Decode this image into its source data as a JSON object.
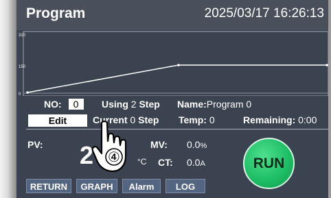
{
  "header": {
    "title": "Program",
    "datetime": "2025/03/17   16:26:13"
  },
  "graph": {
    "y_ticks": [
      "310",
      "150",
      "0"
    ]
  },
  "program": {
    "no_label": "NO:",
    "no_value": "0",
    "using_label": "Using",
    "using_value": "2",
    "step_label": "Step",
    "name_label": "Name:",
    "name_value": "Program 0",
    "edit_label": "Edit",
    "current_label": "Current",
    "current_value": "0",
    "current_step_label": "Step",
    "temp_label": "Temp:",
    "temp_value": "0",
    "remaining_label": "Remaining:",
    "remaining_value": "0:00"
  },
  "readings": {
    "pv_label": "PV:",
    "pv_value": "2",
    "unit_c": "°C",
    "mv_label": "MV:",
    "mv_value": "0.0",
    "mv_unit": "%",
    "ct_label": "CT:",
    "ct_value": "0.0",
    "ct_unit": "A"
  },
  "run_label": "RUN",
  "footer": {
    "return_label": "RETURN",
    "graph_label": "GRAPH",
    "alarm_label": "Alarm",
    "log_label": "LOG"
  },
  "annotation": "④",
  "colors": {
    "screen_bg": "#3b4250",
    "run_green": "#1fbf66",
    "footer_button": "#546581"
  }
}
